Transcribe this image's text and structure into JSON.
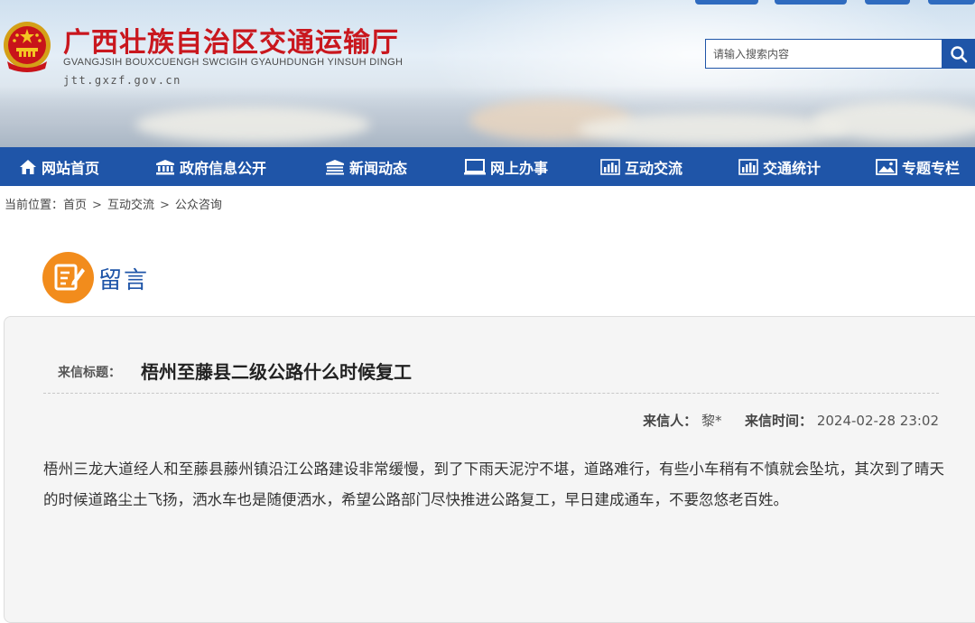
{
  "header": {
    "site_title": "广西壮族自治区交通运输厅",
    "site_pinyin": "GVANGJSIH BOUXCUENGH SWCIGIH GYAUHDUNGH YINSUH DINGH",
    "site_domain": "jtt.gxzf.gov.cn",
    "search_placeholder": "请输入搜索内容"
  },
  "nav": {
    "items": [
      {
        "label": "网站首页",
        "icon": "home-icon"
      },
      {
        "label": "政府信息公开",
        "icon": "building-icon"
      },
      {
        "label": "新闻动态",
        "icon": "news-icon"
      },
      {
        "label": "网上办事",
        "icon": "monitor-icon"
      },
      {
        "label": "互动交流",
        "icon": "chart-icon"
      },
      {
        "label": "交通统计",
        "icon": "chart-icon"
      },
      {
        "label": "专题专栏",
        "icon": "image-icon"
      }
    ]
  },
  "breadcrumb": {
    "prefix": "当前位置：",
    "items": [
      "首页",
      "互动交流",
      "公众咨询"
    ],
    "separator": ">"
  },
  "section": {
    "title": "留言",
    "icon": "edit-note-icon"
  },
  "message": {
    "subject_label": "来信标题：",
    "subject": "梧州至藤县二级公路什么时候复工",
    "sender_label": "来信人：",
    "sender": "黎*",
    "time_label": "来信时间：",
    "time": "2024-02-28 23:02",
    "body": "梧州三龙大道经人和至藤县藤州镇沿江公路建设非常缓慢，到了下雨天泥泞不堪，道路难行，有些小车稍有不慎就会坠坑，其次到了晴天的时候道路尘土飞扬，洒水车也是随便洒水，希望公路部门尽快推进公路复工，早日建成通车，不要忽悠老百姓。"
  },
  "colors": {
    "brand_blue": "#1f55a8",
    "title_red": "#c9171e",
    "accent_orange": "#f28c1c"
  }
}
